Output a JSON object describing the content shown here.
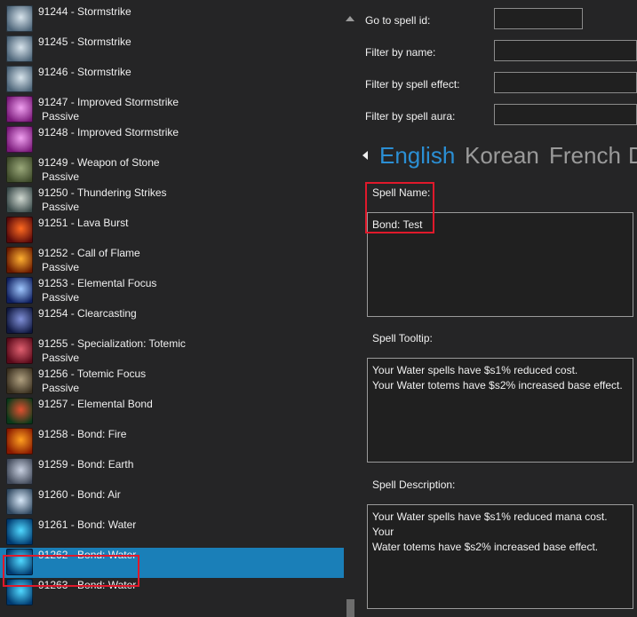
{
  "spells": [
    {
      "label": "91244 - Stormstrike",
      "passive": "",
      "icon": "stormstrike-icon",
      "c1": "#4c6478",
      "c2": "#d8e4ec"
    },
    {
      "label": "91245 - Stormstrike",
      "passive": "",
      "icon": "stormstrike-icon",
      "c1": "#4c6478",
      "c2": "#d8e4ec"
    },
    {
      "label": "91246 - Stormstrike",
      "passive": "",
      "icon": "stormstrike-icon",
      "c1": "#4c6478",
      "c2": "#d8e4ec"
    },
    {
      "label": "91247 - Improved Stormstrike",
      "passive": "Passive",
      "icon": "improved-stormstrike-icon",
      "c1": "#7a1a7a",
      "c2": "#f0a0f0"
    },
    {
      "label": "91248 - Improved Stormstrike",
      "passive": "",
      "icon": "improved-stormstrike-icon",
      "c1": "#7a1a7a",
      "c2": "#f0a0f0"
    },
    {
      "label": "91249 - Weapon of Stone",
      "passive": "Passive",
      "icon": "weapon-of-stone-icon",
      "c1": "#3e4a2a",
      "c2": "#9aa87a"
    },
    {
      "label": "91250 - Thundering Strikes",
      "passive": "Passive",
      "icon": "thundering-strikes-icon",
      "c1": "#3a4a4a",
      "c2": "#d0d8d0"
    },
    {
      "label": "91251 - Lava Burst",
      "passive": "",
      "icon": "lava-burst-icon",
      "c1": "#5a0a0a",
      "c2": "#ff6a20"
    },
    {
      "label": "91252 - Call of Flame",
      "passive": "Passive",
      "icon": "call-of-flame-icon",
      "c1": "#6a1a00",
      "c2": "#ffb030"
    },
    {
      "label": "91253 - Elemental Focus",
      "passive": "Passive",
      "icon": "elemental-focus-icon",
      "c1": "#102060",
      "c2": "#a0c8ff"
    },
    {
      "label": "91254 - Clearcasting",
      "passive": "",
      "icon": "clearcasting-icon",
      "c1": "#101840",
      "c2": "#8090d8"
    },
    {
      "label": "91255 - Specialization: Totemic",
      "passive": "Passive",
      "icon": "totemic-icon",
      "c1": "#5a0a1a",
      "c2": "#e06070"
    },
    {
      "label": "91256 - Totemic Focus",
      "passive": "Passive",
      "icon": "totemic-focus-icon",
      "c1": "#3a3020",
      "c2": "#b0a080"
    },
    {
      "label": "91257 - Elemental Bond",
      "passive": "",
      "icon": "elemental-bond-icon",
      "c1": "#0a3a1a",
      "c2": "#e05030"
    },
    {
      "label": "91258 - Bond: Fire",
      "passive": "",
      "icon": "bond-fire-icon",
      "c1": "#8a1a00",
      "c2": "#ffa020"
    },
    {
      "label": "91259 - Bond: Earth",
      "passive": "",
      "icon": "bond-earth-icon",
      "c1": "#404858",
      "c2": "#c8d0e0"
    },
    {
      "label": "91260 - Bond: Air",
      "passive": "",
      "icon": "bond-air-icon",
      "c1": "#304860",
      "c2": "#d8e8f8"
    },
    {
      "label": "91261 - Bond: Water",
      "passive": "",
      "icon": "bond-water-icon",
      "c1": "#003a70",
      "c2": "#50d8ff"
    },
    {
      "label": "91262 - Bond: Water",
      "passive": "",
      "icon": "bond-water-icon",
      "c1": "#003a70",
      "c2": "#50d8ff"
    },
    {
      "label": "91263 - Bond: Water",
      "passive": "",
      "icon": "bond-water-icon",
      "c1": "#003a70",
      "c2": "#50d8ff"
    }
  ],
  "selected_index": 18,
  "filters": {
    "go_to_id": "Go to spell id:",
    "by_name": "Filter by name:",
    "by_effect": "Filter by spell effect:",
    "by_aura": "Filter by spell aura:"
  },
  "languages": [
    "English",
    "Korean",
    "French",
    "D"
  ],
  "active_language": "English",
  "spell_name_label": "Spell Name:",
  "spell_name_value": "Bond: Test",
  "tooltip_label": "Spell Tooltip:",
  "tooltip_lines": [
    "Your Water spells have $s1% reduced cost.",
    "Your Water totems have $s2% increased base effect."
  ],
  "description_label": "Spell Description:",
  "description_lines": [
    "Your Water spells have $s1% reduced mana cost. Your",
    "Water totems have $s2% increased base effect."
  ],
  "colors": {
    "selected": "#1a7fb8",
    "accent_tab": "#2b8fd4",
    "highlight": "#e0192b"
  }
}
